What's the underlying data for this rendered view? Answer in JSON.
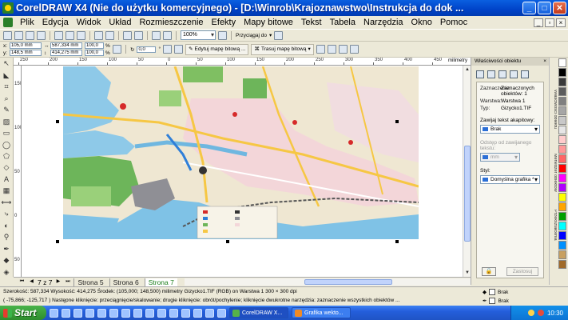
{
  "window": {
    "title": "CorelDRAW X4 (Nie do użytku komercyjnego) - [D:\\Winrob\\Krajoznawstwo\\Instrukcja do dok ...",
    "minimize": "_",
    "maximize": "□",
    "close": "✕"
  },
  "menu": [
    "Plik",
    "Edycja",
    "Widok",
    "Układ",
    "Rozmieszczenie",
    "Efekty",
    "Mapy bitowe",
    "Tekst",
    "Tabela",
    "Narzędzia",
    "Okno",
    "Pomoc"
  ],
  "toolbar1": {
    "zoom": "100%",
    "snap_label": "Przyciągaj do"
  },
  "propbar": {
    "x": "105,0 mm",
    "y": "148,5 mm",
    "width": "587,334 mm",
    "height": "414,275 mm",
    "scale_x": "100,0",
    "scale_y": "100,0",
    "pct": "%",
    "angle": "0,0",
    "edit_bitmap": "Edytuj mapę bitową ...",
    "trace_bitmap": "Trasuj mapę bitową"
  },
  "ruler": {
    "unit": "milimetry",
    "top_labels": [
      "250",
      "200",
      "150",
      "100",
      "50",
      "0",
      "50",
      "100",
      "150",
      "200",
      "250",
      "300",
      "350",
      "400",
      "450"
    ],
    "left_labels": [
      "150",
      "100",
      "50",
      "0",
      "50"
    ]
  },
  "docker": {
    "title": "Właściwości obiektu",
    "selection_label": "Zaznaczenie:",
    "selection_value": "Zaznaczonych obiektów: 1",
    "layer_label": "Warstwa:",
    "layer_value": "Warstwa 1",
    "type_label": "Typ:",
    "type_value": "Gizycko1.TIF",
    "wrap_label": "Zawijaj tekst akapitowy:",
    "wrap_value": "Brak",
    "offset_label": "Odstęp od zawijanego tekstu:",
    "offset_value": "mm",
    "style_label": "Styl:",
    "style_value": "Domyślna grafika *",
    "apply_label": "Zastosuj",
    "lock_label": "🔒"
  },
  "vert_tabs": [
    "Właściwości obiektu",
    "Menedżer obiektów",
    "Przekształcenia"
  ],
  "palette_colors": [
    "#ffffff",
    "#000000",
    "#3a3a3a",
    "#5c5c5c",
    "#808080",
    "#a6a6a6",
    "#c8c8c8",
    "#e6e6e6",
    "#ffcccc",
    "#ff9999",
    "#ff6666",
    "#ff0000",
    "#ff00ff",
    "#b000ff",
    "#ffff00",
    "#ffa500",
    "#00a000",
    "#00ffff",
    "#0000ff",
    "#0090ff",
    "#c8a060",
    "#a06a2a"
  ],
  "pagebar": {
    "page_counter": "7 z 7",
    "tabs": [
      "Strona 5",
      "Strona 6",
      "Strona 7"
    ]
  },
  "status": {
    "line1": "Szerokość: 587,334  Wysokość: 414,275  Środek: (105,000; 148,500) milimetry        Gizycko1.TIF (RGB) on Warstwa 1 300 × 300 dpi",
    "line2": "( -75,866; -125,717 )     Następne kliknięcie: przeciągnięcie/skalowanie; drugie kliknięcie: obrót/pochylenie; kliknięcie dwukrotne narzędzia: zaznaczenie wszystkich obiektów ...",
    "fill_label": "Brak",
    "outline_label": "Brak"
  },
  "taskbar": {
    "start": "Start",
    "tasks": [
      "CorelDRAW X...",
      "Grafika wekto..."
    ],
    "clock": "10:30"
  }
}
